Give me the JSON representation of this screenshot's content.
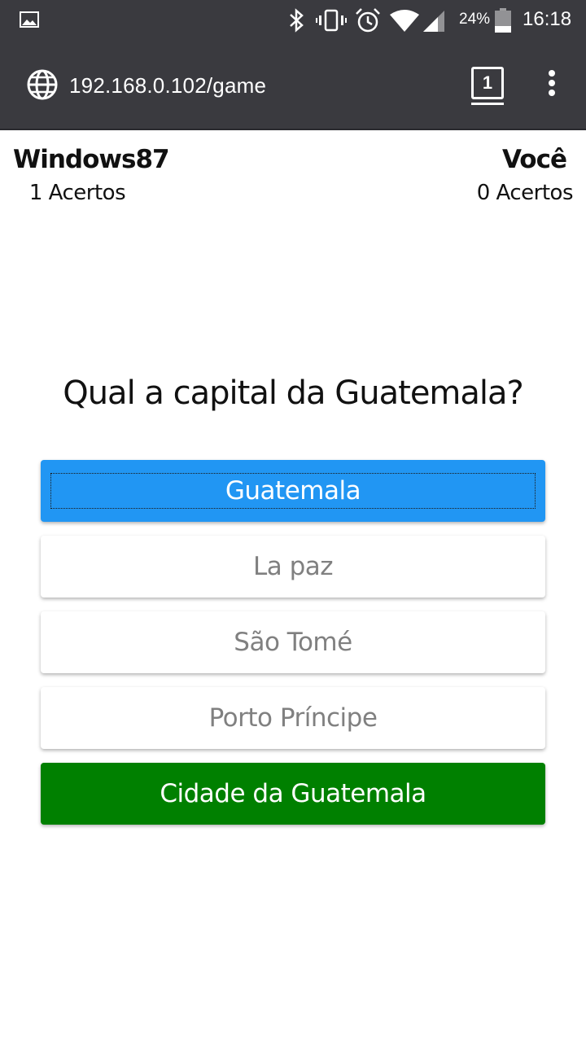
{
  "status_bar": {
    "battery_percent": "24%",
    "time": "16:18",
    "icons": [
      "gallery-icon",
      "bluetooth-icon",
      "vibrate-icon",
      "alarm-icon",
      "wifi-icon",
      "signal-icon",
      "battery-icon"
    ]
  },
  "browser": {
    "url": "192.168.0.102/game",
    "tab_count": "1"
  },
  "players": {
    "opponent": {
      "name": "Windows87",
      "score": "1 Acertos"
    },
    "you": {
      "name": "Você",
      "score": "0 Acertos"
    }
  },
  "question": "Qual a capital da Guatemala?",
  "answers": [
    {
      "label": "Guatemala",
      "state": "selected"
    },
    {
      "label": "La paz",
      "state": "default"
    },
    {
      "label": "São Tomé",
      "state": "default"
    },
    {
      "label": "Porto Príncipe",
      "state": "default"
    },
    {
      "label": "Cidade da Guatemala",
      "state": "correct"
    }
  ],
  "colors": {
    "selected": "#2196f3",
    "correct": "#008000",
    "toolbar": "#3a3a3f"
  }
}
